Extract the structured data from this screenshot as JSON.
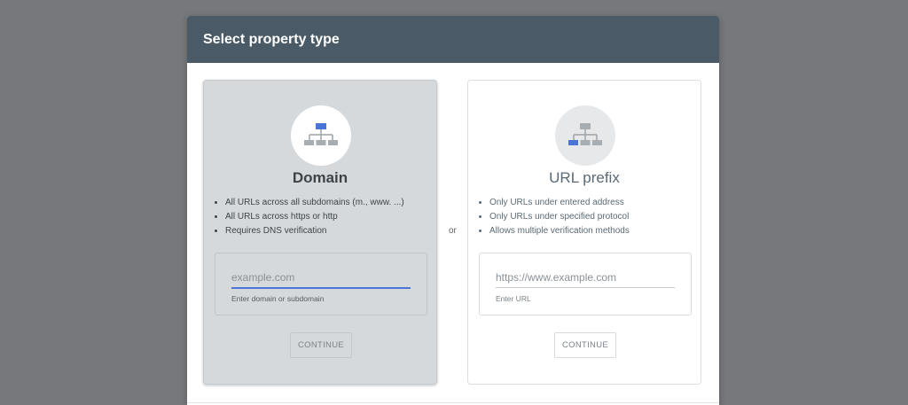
{
  "dialog": {
    "title": "Select property type",
    "or_label": "or"
  },
  "domain_card": {
    "title": "Domain",
    "icon": "sitemap-top-highlight-icon",
    "features": [
      "All URLs across all subdomains (m., www. ...)",
      "All URLs across https or http",
      "Requires DNS verification"
    ],
    "input": {
      "value": "",
      "placeholder": "example.com"
    },
    "hint": "Enter domain or subdomain",
    "continue_label": "CONTINUE"
  },
  "url_card": {
    "title": "URL prefix",
    "icon": "sitemap-bottom-left-highlight-icon",
    "features": [
      "Only URLs under entered address",
      "Only URLs under specified protocol",
      "Allows multiple verification methods"
    ],
    "input": {
      "value": "",
      "placeholder": "https://www.example.com"
    },
    "hint": "Enter URL",
    "continue_label": "CONTINUE"
  },
  "colors": {
    "header": "#4a5a66",
    "accent": "#4a74d6",
    "backdrop": "#77787b"
  }
}
